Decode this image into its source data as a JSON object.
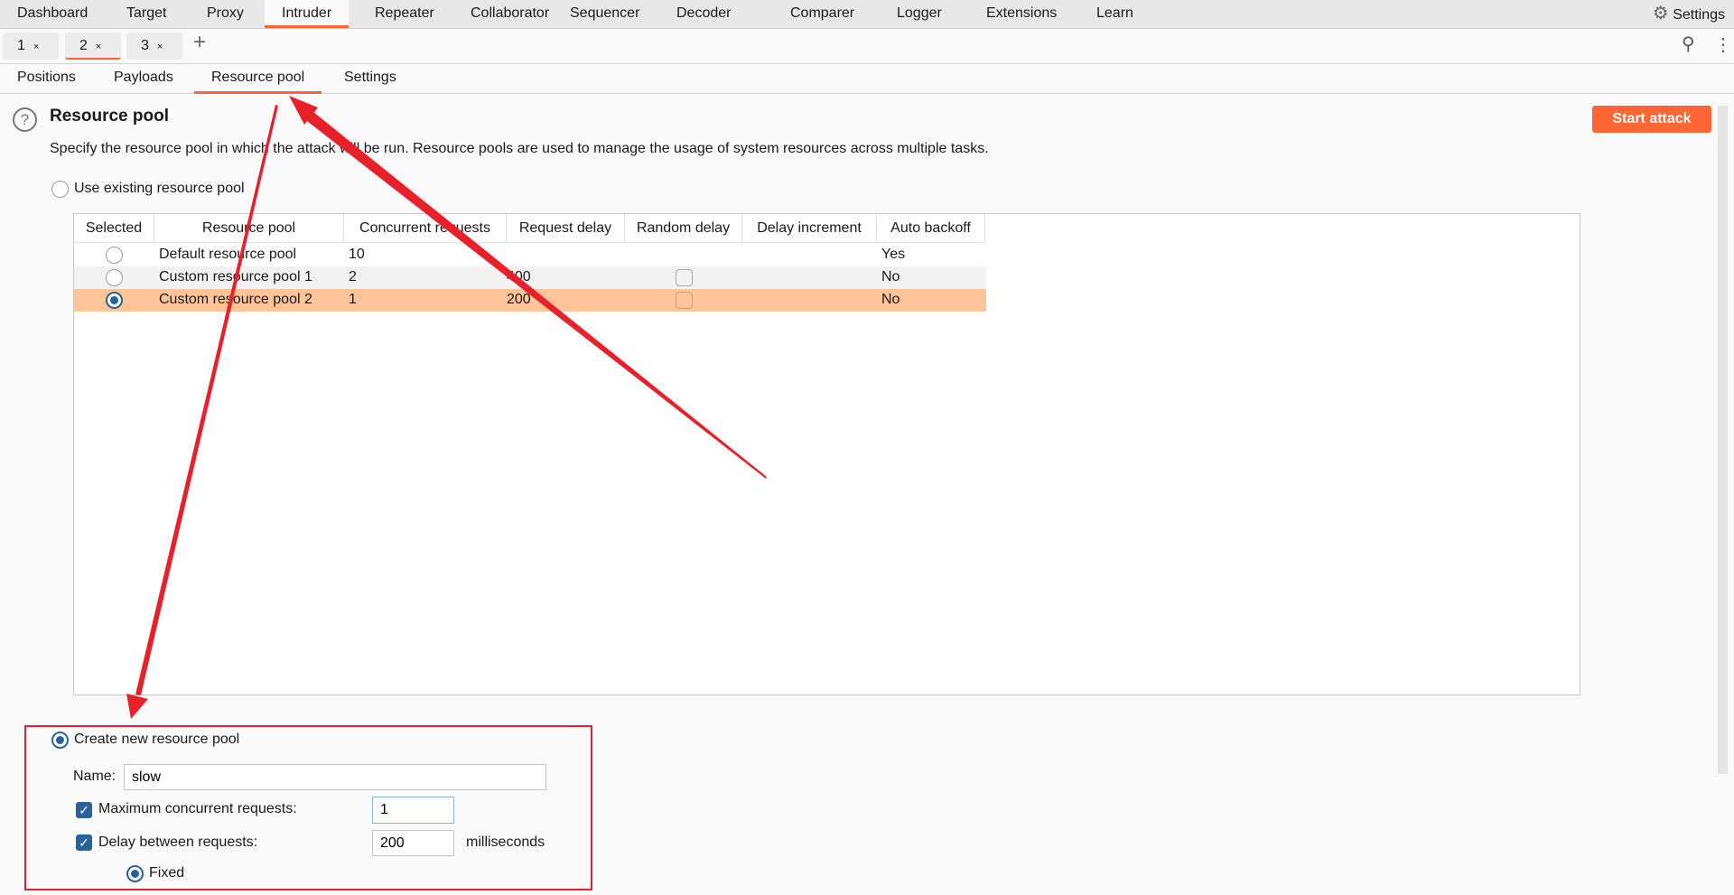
{
  "colors": {
    "accent": "#ff6633",
    "selected_row": "#ffc497",
    "annotation": "#e8202a",
    "radio": "#2b6099"
  },
  "topnav": {
    "items": [
      "Dashboard",
      "Target",
      "Proxy",
      "Intruder",
      "Repeater",
      "Collaborator",
      "Sequencer",
      "Decoder",
      "Comparer",
      "Logger",
      "Extensions",
      "Learn"
    ],
    "active": "Intruder",
    "settings": "Settings"
  },
  "request_tabs": [
    {
      "label": "1",
      "close": "×"
    },
    {
      "label": "2",
      "close": "×"
    },
    {
      "label": "3",
      "close": "×"
    }
  ],
  "add_tab": "+",
  "subtabs": {
    "items": [
      "Positions",
      "Payloads",
      "Resource pool",
      "Settings"
    ],
    "active": "Resource pool"
  },
  "section": {
    "title": "Resource pool",
    "description": "Specify the resource pool in which the attack will be run. Resource pools are used to manage the usage of system resources across multiple tasks.",
    "start_attack": "Start attack"
  },
  "existing": {
    "label": "Use existing resource pool",
    "selected": false,
    "columns": [
      "Selected",
      "Resource pool",
      "Concurrent requests",
      "Request delay",
      "Random delay",
      "Delay increment",
      "Auto backoff"
    ],
    "rows": [
      {
        "selected": false,
        "name": "Default resource pool",
        "concurrent": "10",
        "delay": "",
        "random": null,
        "increment": "",
        "backoff": "Yes"
      },
      {
        "selected": false,
        "name": "Custom resource pool 1",
        "concurrent": "2",
        "delay": "400",
        "random": false,
        "increment": "",
        "backoff": "No"
      },
      {
        "selected": true,
        "name": "Custom resource pool 2",
        "concurrent": "1",
        "delay": "200",
        "random": false,
        "increment": "",
        "backoff": "No"
      }
    ]
  },
  "create": {
    "label": "Create new resource pool",
    "selected": true,
    "name_label": "Name:",
    "name_value": "slow",
    "max_label": "Maximum concurrent requests:",
    "max_checked": true,
    "max_value": "1",
    "delay_label": "Delay between requests:",
    "delay_checked": true,
    "delay_value": "200",
    "delay_unit": "milliseconds",
    "fixed_label": "Fixed",
    "fixed_selected": true
  }
}
